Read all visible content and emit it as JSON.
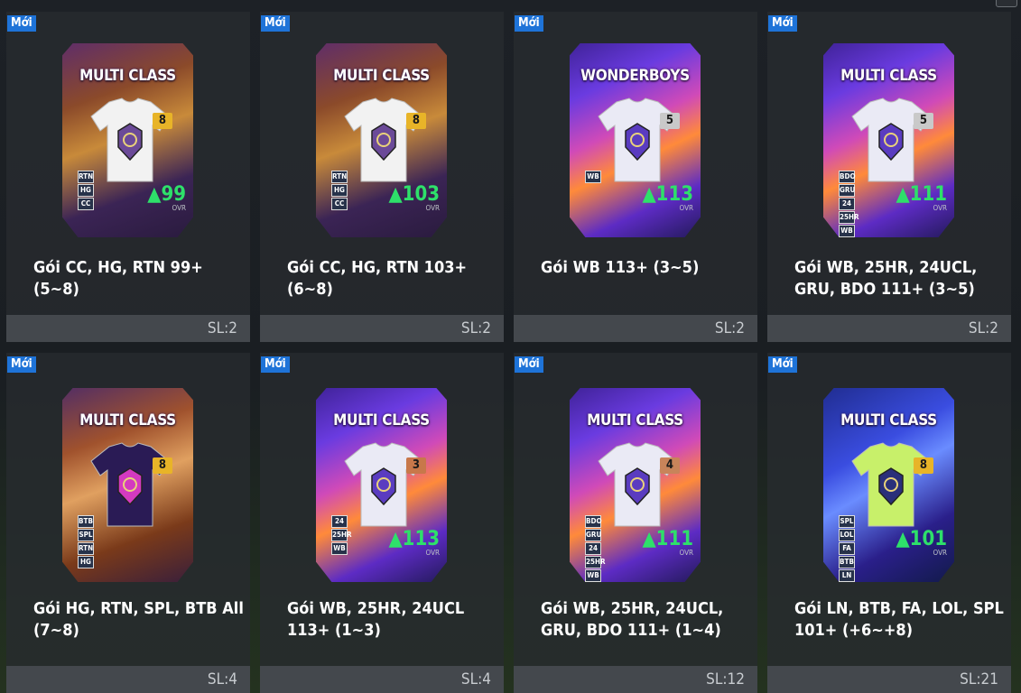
{
  "badge_label": "Mới",
  "packs": [
    {
      "title": "Gói CC, HG, RTN 99+ (5~8)",
      "count": "SL:2",
      "banner": "MULTI CLASS",
      "tier": "8",
      "ovr": "99",
      "ovr_label": "OVR",
      "tags": [
        "RTN",
        "HG",
        "CC"
      ],
      "theme": "gold"
    },
    {
      "title": "Gói CC, HG, RTN 103+ (6~8)",
      "count": "SL:2",
      "banner": "MULTI CLASS",
      "tier": "8",
      "ovr": "103",
      "ovr_label": "OVR",
      "tags": [
        "RTN",
        "HG",
        "CC"
      ],
      "theme": "gold"
    },
    {
      "title": "Gói WB 113+ (3~5)",
      "count": "SL:2",
      "banner": "WONDERBOYS",
      "tier": "5",
      "ovr": "113",
      "ovr_label": "OVR",
      "tags": [
        "WB"
      ],
      "theme": "purple"
    },
    {
      "title": "Gói WB, 25HR, 24UCL, GRU, BDO 111+ (3~5)",
      "count": "SL:2",
      "banner": "MULTI CLASS",
      "tier": "5",
      "ovr": "111",
      "ovr_label": "OVR",
      "tags": [
        "BDO",
        "GRU",
        "24",
        "25HR",
        "WB"
      ],
      "theme": "purple"
    },
    {
      "title": "Gói HG, RTN, SPL, BTB All (7~8)",
      "count": "SL:4",
      "banner": "MULTI CLASS",
      "tier": "8",
      "ovr": "",
      "ovr_label": "",
      "tags": [
        "BTB",
        "SPL",
        "RTN",
        "HG"
      ],
      "theme": "bronze"
    },
    {
      "title": "Gói WB, 25HR, 24UCL 113+ (1~3)",
      "count": "SL:4",
      "banner": "MULTI CLASS",
      "tier": "3",
      "ovr": "113",
      "ovr_label": "OVR",
      "tags": [
        "24",
        "25HR",
        "WB"
      ],
      "theme": "purple"
    },
    {
      "title": "Gói WB, 25HR, 24UCL, GRU, BDO 111+ (1~4)",
      "count": "SL:12",
      "banner": "MULTI CLASS",
      "tier": "4",
      "ovr": "111",
      "ovr_label": "OVR",
      "tags": [
        "BDO",
        "GRU",
        "24",
        "25HR",
        "WB"
      ],
      "theme": "purple"
    },
    {
      "title": "Gói LN, BTB, FA, LOL, SPL 101+ (+6~+8)",
      "count": "SL:21",
      "banner": "MULTI CLASS",
      "tier": "8",
      "ovr": "101",
      "ovr_label": "OVR",
      "tags": [
        "SPL",
        "LOL",
        "FA",
        "BTB",
        "LN"
      ],
      "theme": "blue"
    }
  ]
}
